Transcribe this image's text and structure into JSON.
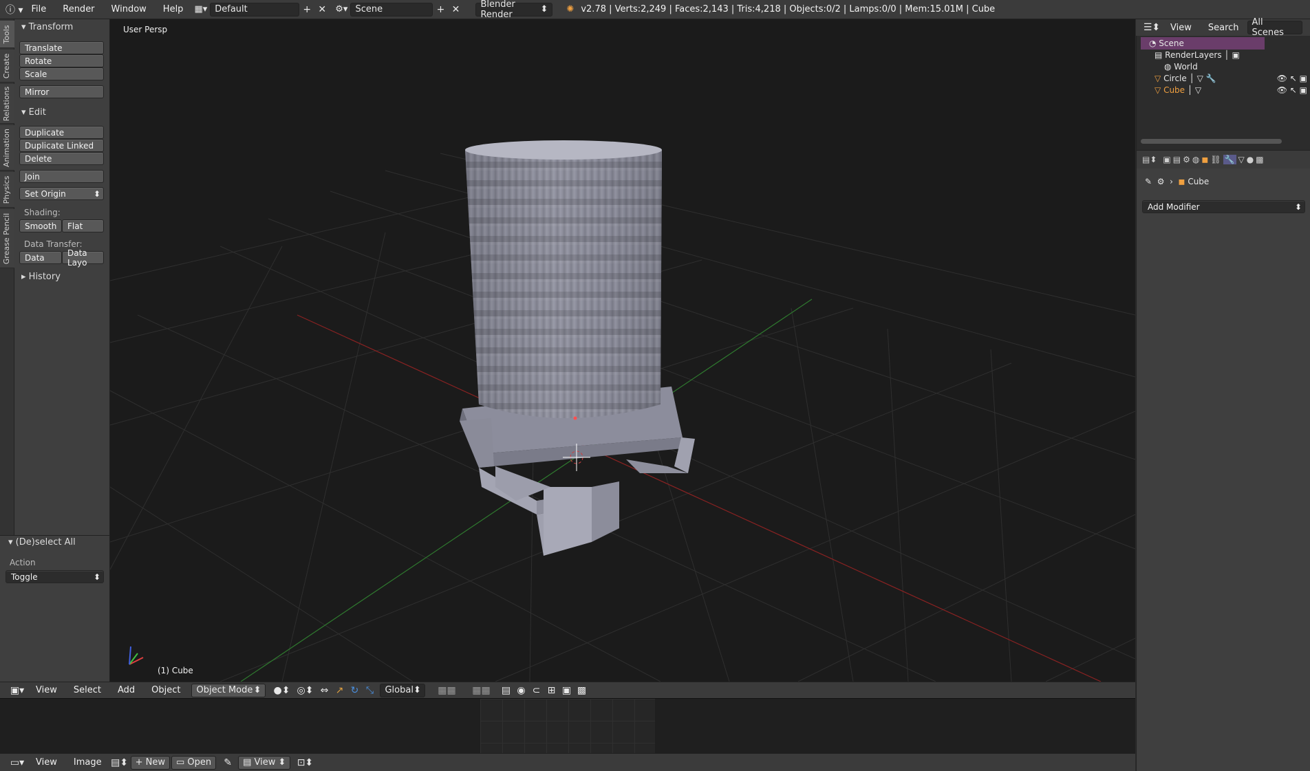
{
  "topbar": {
    "menus": [
      "File",
      "Render",
      "Window",
      "Help"
    ],
    "layout": "Default",
    "scene": "Scene",
    "engine": "Blender Render",
    "stats": "v2.78 | Verts:2,249 | Faces:2,143 | Tris:4,218 | Objects:0/2 | Lamps:0/0 | Mem:15.01M | Cube"
  },
  "vtabs": [
    "Tools",
    "Create",
    "Relations",
    "Animation",
    "Physics",
    "Grease Pencil"
  ],
  "toolshelf": {
    "transform": {
      "title": "Transform",
      "buttons": [
        "Translate",
        "Rotate",
        "Scale",
        "Mirror"
      ]
    },
    "edit": {
      "title": "Edit",
      "buttons": [
        "Duplicate",
        "Duplicate Linked",
        "Delete",
        "Join"
      ],
      "set_origin": "Set Origin"
    },
    "shading": {
      "label": "Shading:",
      "smooth": "Smooth",
      "flat": "Flat"
    },
    "data_transfer": {
      "label": "Data Transfer:",
      "data": "Data",
      "data_layout": "Data Layo"
    },
    "history": "History"
  },
  "operator_panel": {
    "title": "(De)select All",
    "action_label": "Action",
    "action_value": "Toggle"
  },
  "viewport": {
    "view_label": "User Persp",
    "object_label": "(1) Cube"
  },
  "vp_header": {
    "menus": [
      "View",
      "Select",
      "Add",
      "Object"
    ],
    "mode": "Object Mode",
    "orientation": "Global"
  },
  "bottom_header": {
    "menus": [
      "View",
      "Image"
    ],
    "new": "New",
    "open": "Open",
    "view": "View"
  },
  "outliner": {
    "menus": [
      "View",
      "Search"
    ],
    "filter": "All Scenes",
    "items": [
      {
        "label": "Scene",
        "selected": true
      },
      {
        "label": "RenderLayers"
      },
      {
        "label": "World"
      },
      {
        "label": "Circle"
      },
      {
        "label": "Cube",
        "active": true
      }
    ]
  },
  "properties": {
    "object": "Cube",
    "add_modifier": "Add Modifier"
  },
  "colors": {
    "accent_orange": "#f0a040",
    "selected_row": "#6a3d6a",
    "grid": "#2f2f2f",
    "x_axis": "#8a2222",
    "y_axis": "#2f7a2f"
  }
}
